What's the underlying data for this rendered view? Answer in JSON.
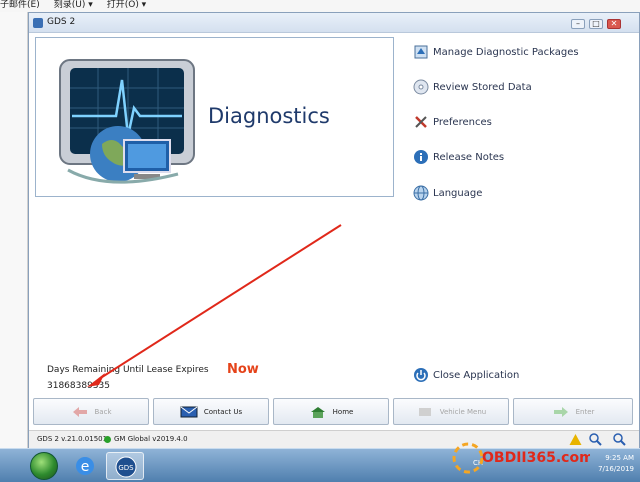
{
  "outer_menu": [
    "子邮件(E)",
    "刻录(U) ▾",
    "打开(O) ▾"
  ],
  "window": {
    "title": "GDS 2"
  },
  "banner": {
    "title": "Diagnostics"
  },
  "menu": [
    {
      "label": "Manage Diagnostic Packages",
      "icon": "package-icon"
    },
    {
      "label": "Review Stored Data",
      "icon": "disc-icon"
    },
    {
      "label": "Preferences",
      "icon": "tools-icon"
    },
    {
      "label": "Release Notes",
      "icon": "info-icon"
    },
    {
      "label": "Language",
      "icon": "globe-icon"
    }
  ],
  "close_app": {
    "label": "Close Application",
    "icon": "power-icon"
  },
  "lease": {
    "label": "Days Remaining Until Lease Expires",
    "value": "31868389335"
  },
  "annotation": {
    "text": "Now",
    "color": "#e5431a"
  },
  "buttons": [
    {
      "label": "Back",
      "enabled": false
    },
    {
      "label": "Contact Us",
      "enabled": true
    },
    {
      "label": "Home",
      "enabled": true
    },
    {
      "label": "Vehicle Menu",
      "enabled": false
    },
    {
      "label": "Enter",
      "enabled": false
    }
  ],
  "status": {
    "version": "GDS 2 v.21.0.01501",
    "global": "GM Global v2019.4.0"
  },
  "taskbar": {
    "time": "9:25 AM",
    "date": "7/16/2019",
    "tray_text": "CH"
  },
  "watermark": "OBDII365.com",
  "colors": {
    "accent": "#1f3a6b",
    "annotation": "#e5431a"
  }
}
